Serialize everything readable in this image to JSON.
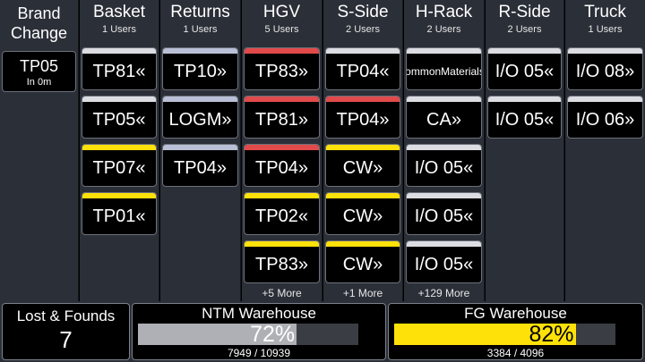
{
  "columns": [
    {
      "title": "Brand Change",
      "brand": {
        "code": "TP05",
        "time": "In 0m"
      }
    },
    {
      "title": "Basket",
      "users": "1 Users",
      "cards": [
        {
          "label": "TP81«",
          "stripe": "white"
        },
        {
          "label": "TP05«",
          "stripe": "white"
        },
        {
          "label": "TP07«",
          "stripe": "yellow"
        },
        {
          "label": "TP01«",
          "stripe": "yellow"
        }
      ]
    },
    {
      "title": "Returns",
      "users": "1 Users",
      "cards": [
        {
          "label": "TP10»",
          "stripe": "blue"
        },
        {
          "label": "LOGM»",
          "stripe": "blue"
        },
        {
          "label": "TP04»",
          "stripe": "blue"
        }
      ]
    },
    {
      "title": "HGV",
      "users": "5 Users",
      "more": "+5 More",
      "cards": [
        {
          "label": "TP83»",
          "stripe": "red"
        },
        {
          "label": "TP81»",
          "stripe": "red"
        },
        {
          "label": "TP04»",
          "stripe": "red"
        },
        {
          "label": "TP02«",
          "stripe": "yellow"
        },
        {
          "label": "TP83»",
          "stripe": "yellow"
        }
      ]
    },
    {
      "title": "S-Side",
      "users": "2 Users",
      "more": "+1 More",
      "cards": [
        {
          "label": "TP04«",
          "stripe": "white"
        },
        {
          "label": "TP04»",
          "stripe": "red"
        },
        {
          "label": "CW»",
          "stripe": "yellow"
        },
        {
          "label": "CW»",
          "stripe": "yellow"
        },
        {
          "label": "CW»",
          "stripe": "yellow"
        }
      ]
    },
    {
      "title": "H-Rack",
      "users": "2 Users",
      "more": "+129 More",
      "cards": [
        {
          "label": "CommonMaterials«",
          "stripe": "white",
          "small": true
        },
        {
          "label": "CA»",
          "stripe": "white"
        },
        {
          "label": "I/O 05«",
          "stripe": "white"
        },
        {
          "label": "I/O 05«",
          "stripe": "white"
        },
        {
          "label": "I/O 05«",
          "stripe": "white"
        }
      ]
    },
    {
      "title": "R-Side",
      "users": "2 Users",
      "cards": [
        {
          "label": "I/O 05«",
          "stripe": "white"
        },
        {
          "label": "I/O 05«",
          "stripe": "white"
        }
      ]
    },
    {
      "title": "Truck",
      "users": "1 Users",
      "cards": [
        {
          "label": "I/O 08»",
          "stripe": "white"
        },
        {
          "label": "I/O 06»",
          "stripe": "white"
        }
      ]
    }
  ],
  "lost_found": {
    "title": "Lost & Founds",
    "count": "7"
  },
  "warehouses": [
    {
      "title": "NTM Warehouse",
      "percent_label": "72%",
      "fraction": 0.72,
      "counts": "7949 / 10939",
      "color": "#aeb0b5"
    },
    {
      "title": "FG Warehouse",
      "percent_label": "82%",
      "fraction": 0.82,
      "counts": "3384 / 4096",
      "color": "#ffe10a"
    }
  ]
}
